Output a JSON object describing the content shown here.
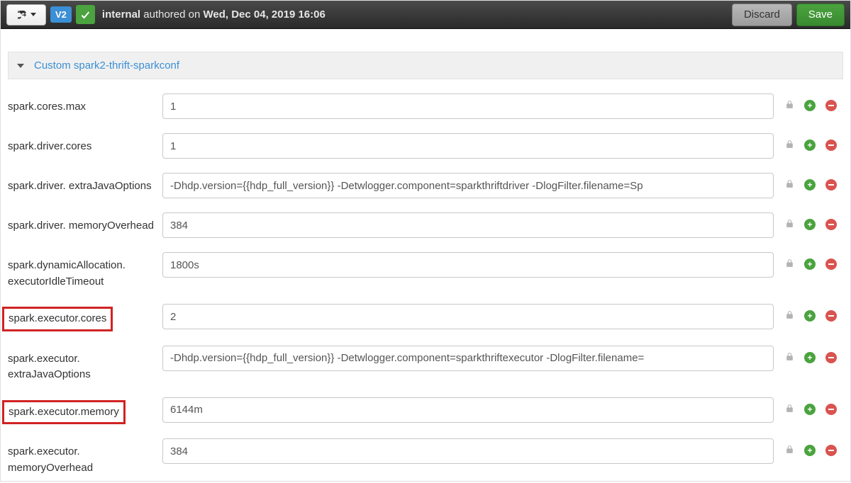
{
  "topbar": {
    "version_badge": "V2",
    "author_prefix": "internal",
    "author_mid": " authored on ",
    "author_date": "Wed, Dec 04, 2019 16:06",
    "discard_label": "Discard",
    "save_label": "Save"
  },
  "section": {
    "title": "Custom spark2-thrift-sparkconf"
  },
  "rows": [
    {
      "label": "spark.cores.max",
      "value": "1",
      "highlight": false
    },
    {
      "label": "spark.driver.cores",
      "value": "1",
      "highlight": false
    },
    {
      "label": "spark.driver. extraJavaOptions",
      "value": "-Dhdp.version={{hdp_full_version}} -Detwlogger.component=sparkthriftdriver -DlogFilter.filename=Sp",
      "highlight": false
    },
    {
      "label": "spark.driver. memoryOverhead",
      "value": "384",
      "highlight": false
    },
    {
      "label": "spark.dynamicAllocation. executorIdleTimeout",
      "value": "1800s",
      "highlight": false
    },
    {
      "label": "spark.executor.cores",
      "value": "2",
      "highlight": true
    },
    {
      "label": "spark.executor. extraJavaOptions",
      "value": "-Dhdp.version={{hdp_full_version}} -Detwlogger.component=sparkthriftexecutor -DlogFilter.filename=",
      "highlight": false
    },
    {
      "label": "spark.executor.memory",
      "value": "6144m",
      "highlight": true
    },
    {
      "label": "spark.executor. memoryOverhead",
      "value": "384",
      "highlight": false
    }
  ]
}
